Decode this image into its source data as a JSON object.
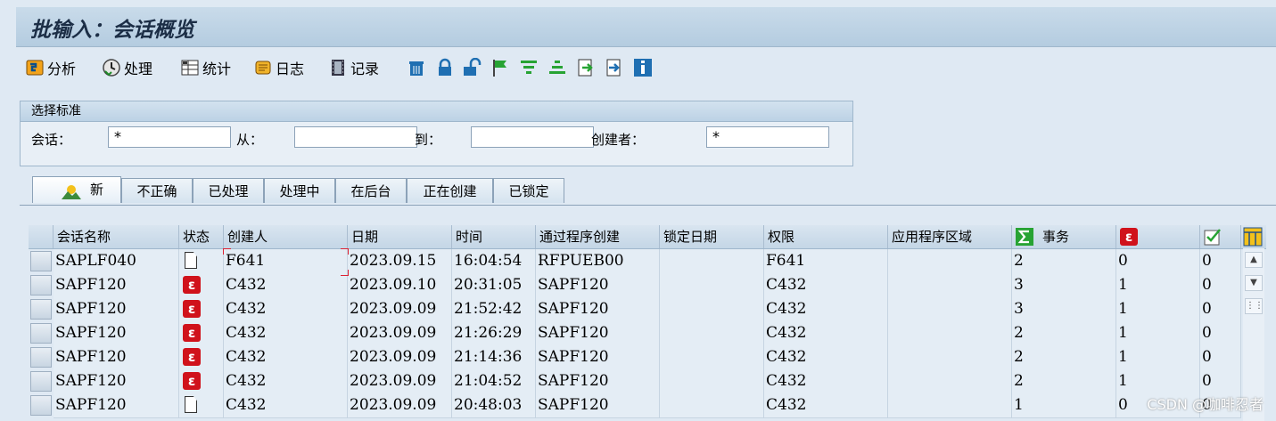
{
  "window": {
    "title": "批输入：会话概览"
  },
  "toolbar": {
    "analyze_label": "分析",
    "process_label": "处理",
    "stats_label": "统计",
    "log_label": "日志",
    "record_label": "记录",
    "icons": [
      "delete-icon",
      "lock-icon",
      "unlock-icon",
      "flag-icon",
      "filter-icon",
      "sort-icon",
      "export-icon",
      "import-icon",
      "info-icon"
    ]
  },
  "criteria": {
    "header": "选择标准",
    "session_label": "会话：",
    "session_value": "*",
    "from_label": "从：",
    "from_value": "",
    "to_label": "到：",
    "to_value": "",
    "creator_label": "创建者：",
    "creator_value": "*"
  },
  "tabs": [
    "新",
    "不正确",
    "已处理",
    "处理中",
    "在后台",
    "正在创建",
    "已锁定"
  ],
  "table": {
    "columns": {
      "name": "会话名称",
      "status": "状态",
      "creator": "创建人",
      "date": "日期",
      "time": "时间",
      "program": "通过程序创建",
      "lockdate": "锁定日期",
      "auth": "权限",
      "area": "应用程序区域",
      "trans": "事务"
    },
    "rows": [
      {
        "name": "SAPLF040",
        "status": "doc",
        "creator": "F641",
        "date": "2023.09.15",
        "time": "16:04:54",
        "program": "RFPUEB00",
        "lockdate": "",
        "auth": "F641",
        "area": "",
        "trans": "2",
        "err": "0",
        "ok": "0"
      },
      {
        "name": "SAPF120",
        "status": "error",
        "creator": "C432",
        "date": "2023.09.10",
        "time": "20:31:05",
        "program": "SAPF120",
        "lockdate": "",
        "auth": "C432",
        "area": "",
        "trans": "3",
        "err": "1",
        "ok": "0"
      },
      {
        "name": "SAPF120",
        "status": "error",
        "creator": "C432",
        "date": "2023.09.09",
        "time": "21:52:42",
        "program": "SAPF120",
        "lockdate": "",
        "auth": "C432",
        "area": "",
        "trans": "3",
        "err": "1",
        "ok": "0"
      },
      {
        "name": "SAPF120",
        "status": "error",
        "creator": "C432",
        "date": "2023.09.09",
        "time": "21:26:29",
        "program": "SAPF120",
        "lockdate": "",
        "auth": "C432",
        "area": "",
        "trans": "2",
        "err": "1",
        "ok": "0"
      },
      {
        "name": "SAPF120",
        "status": "error",
        "creator": "C432",
        "date": "2023.09.09",
        "time": "21:14:36",
        "program": "SAPF120",
        "lockdate": "",
        "auth": "C432",
        "area": "",
        "trans": "2",
        "err": "1",
        "ok": "0"
      },
      {
        "name": "SAPF120",
        "status": "error",
        "creator": "C432",
        "date": "2023.09.09",
        "time": "21:04:52",
        "program": "SAPF120",
        "lockdate": "",
        "auth": "C432",
        "area": "",
        "trans": "2",
        "err": "1",
        "ok": "0"
      },
      {
        "name": "SAPF120",
        "status": "doc",
        "creator": "C432",
        "date": "2023.09.09",
        "time": "20:48:03",
        "program": "SAPF120",
        "lockdate": "",
        "auth": "C432",
        "area": "",
        "trans": "1",
        "err": "0",
        "ok": "0"
      }
    ]
  },
  "watermark": "CSDN @咖啡忍者",
  "colors": {
    "accent": "#d0121b",
    "title": "#1c2e46",
    "background": "#dfe9f3"
  }
}
